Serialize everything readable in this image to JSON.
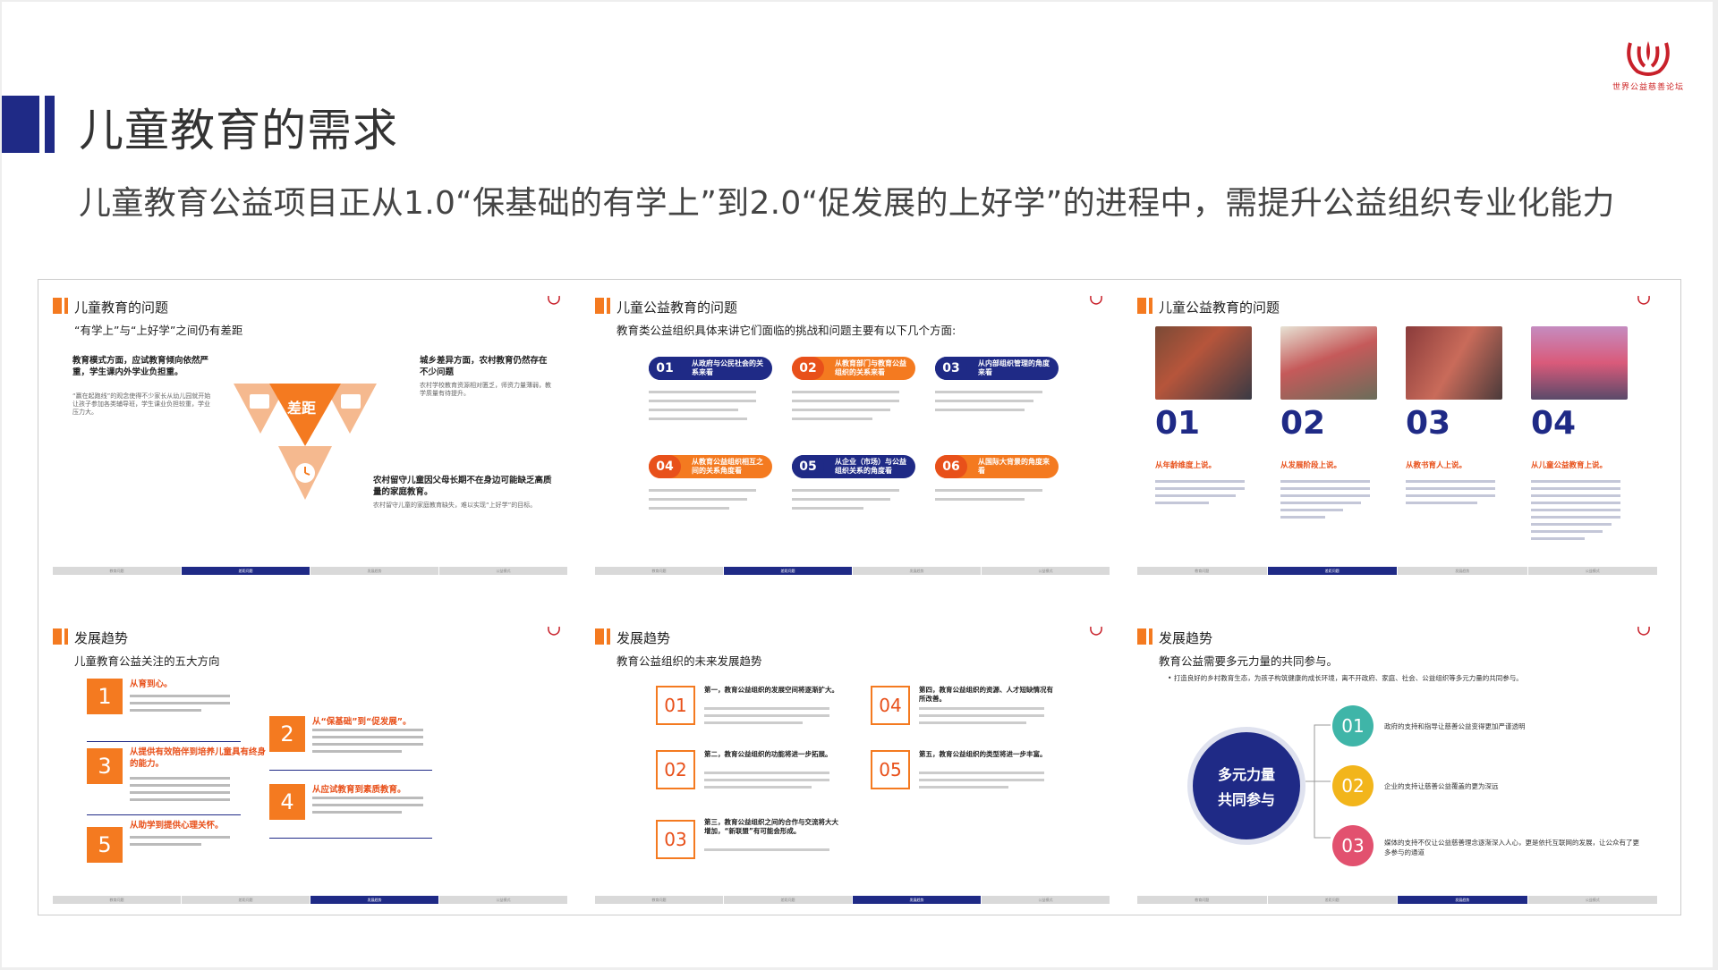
{
  "header": {
    "title": "儿童教育的需求",
    "subtitle": "儿童教育公益项目正从1.0“保基础的有学上”到2.0“促发展的上好学”的进程中，需提升公益组织专业化能力",
    "logo_text": "世界公益慈善论坛"
  },
  "colors": {
    "navy": "#1f2a86",
    "orange": "#f47a20",
    "teal": "#3fb5a8",
    "yellow": "#f2b51b",
    "pink": "#e2516f"
  },
  "cards": {
    "c1": {
      "title": "儿童教育的问题",
      "sub": "“有学上”与“上好学”之间仍有差距",
      "p1_head": "教育模式方面，应试教育倾向依然严重，学生课内外学业负担重。",
      "p1_body": "“赢在起跑线”的观念使得不少家长从幼儿园就开始让孩子参加各类辅导班，学生课业负担较重，学业压力大。",
      "p2_head": "城乡差异方面，农村教育仍然存在不少问题",
      "p2_body": "农村学校教育资源相对匮乏，师资力量薄弱，教学质量有待提升。",
      "p3_head": "农村留守儿童因父母长期不在身边可能缺乏高质量的家庭教育。",
      "p3_body": "农村留守儿童的家庭教育缺失，难以实现“上好学”的目标。",
      "center": "差距",
      "nav": [
        "教育问题",
        "差距问题",
        "发展趋势",
        "公益模式"
      ]
    },
    "c2": {
      "title": "儿童公益教育的问题",
      "sub": "教育类公益组织具体来讲它们面临的挑战和问题主要有以下几个方面:",
      "items": [
        {
          "num": "01",
          "label": "从政府与公民社会的关系来看"
        },
        {
          "num": "02",
          "label": "从教育部门与教育公益组织的关系来看"
        },
        {
          "num": "03",
          "label": "从内部组织管理的角度来看"
        },
        {
          "num": "04",
          "label": "从教育公益组织相互之间的关系角度看"
        },
        {
          "num": "05",
          "label": "从企业（市场）与公益组织关系的角度看"
        },
        {
          "num": "06",
          "label": "从国际大背景的角度来看"
        }
      ],
      "nav": [
        "教育问题",
        "差距问题",
        "发展趋势",
        "公益模式"
      ]
    },
    "c3": {
      "title": "儿童公益教育的问题",
      "nums": [
        "01",
        "02",
        "03",
        "04"
      ],
      "heads": [
        "从年龄维度上说。",
        "从发展阶段上说。",
        "从教书育人上说。",
        "从儿童公益教育上说。"
      ],
      "nav": [
        "教育问题",
        "差距问题",
        "发展趋势",
        "公益模式"
      ]
    },
    "c4": {
      "title": "发展趋势",
      "sub": "儿童教育公益关注的五大方向",
      "items": [
        {
          "num": "1",
          "head": "从育到心。"
        },
        {
          "num": "2",
          "head": "从“保基础”到“促发展”。"
        },
        {
          "num": "3",
          "head": "从提供有效陪伴到培养儿童具有终身的能力。"
        },
        {
          "num": "4",
          "head": "从应试教育到素质教育。"
        },
        {
          "num": "5",
          "head": "从助学到提供心理关怀。"
        }
      ],
      "nav": [
        "教育问题",
        "差距问题",
        "发展趋势",
        "公益模式"
      ]
    },
    "c5": {
      "title": "发展趋势",
      "sub": "教育公益组织的未来发展趋势",
      "items": [
        {
          "num": "01",
          "head": "第一，教育公益组织的发展空间将逐渐扩大。"
        },
        {
          "num": "02",
          "head": "第二，教育公益组织的功能将进一步拓展。"
        },
        {
          "num": "03",
          "head": "第三，教育公益组织之间的合作与交流将大大增加，“新联盟”有可能会形成。"
        },
        {
          "num": "04",
          "head": "第四，教育公益组织的资源、人才短缺情况有所改善。"
        },
        {
          "num": "05",
          "head": "第五，教育公益组织的类型将进一步丰富。"
        }
      ],
      "nav": [
        "教育问题",
        "差距问题",
        "发展趋势",
        "公益模式"
      ]
    },
    "c6": {
      "title": "发展趋势",
      "sub": "教育公益需要多元力量的共同参与。",
      "bullet": "打造良好的乡村教育生态，为孩子构筑健康的成长环境，离不开政府、家庭、社会、公益组织等多元力量的共同参与。",
      "circle": [
        "多元力量",
        "共同参与"
      ],
      "items": [
        {
          "num": "01",
          "text": "政府的支持和指导让慈善公益变得更加严谨透明"
        },
        {
          "num": "02",
          "text": "企业的支持让慈善公益覆盖的更为深远"
        },
        {
          "num": "03",
          "text": "媒体的支持不仅让公益慈善理念逐渐深入人心，更是依托互联网的发展，让公众有了更多参与的通道"
        }
      ],
      "nav": [
        "教育问题",
        "差距问题",
        "发展趋势",
        "公益模式"
      ]
    }
  }
}
